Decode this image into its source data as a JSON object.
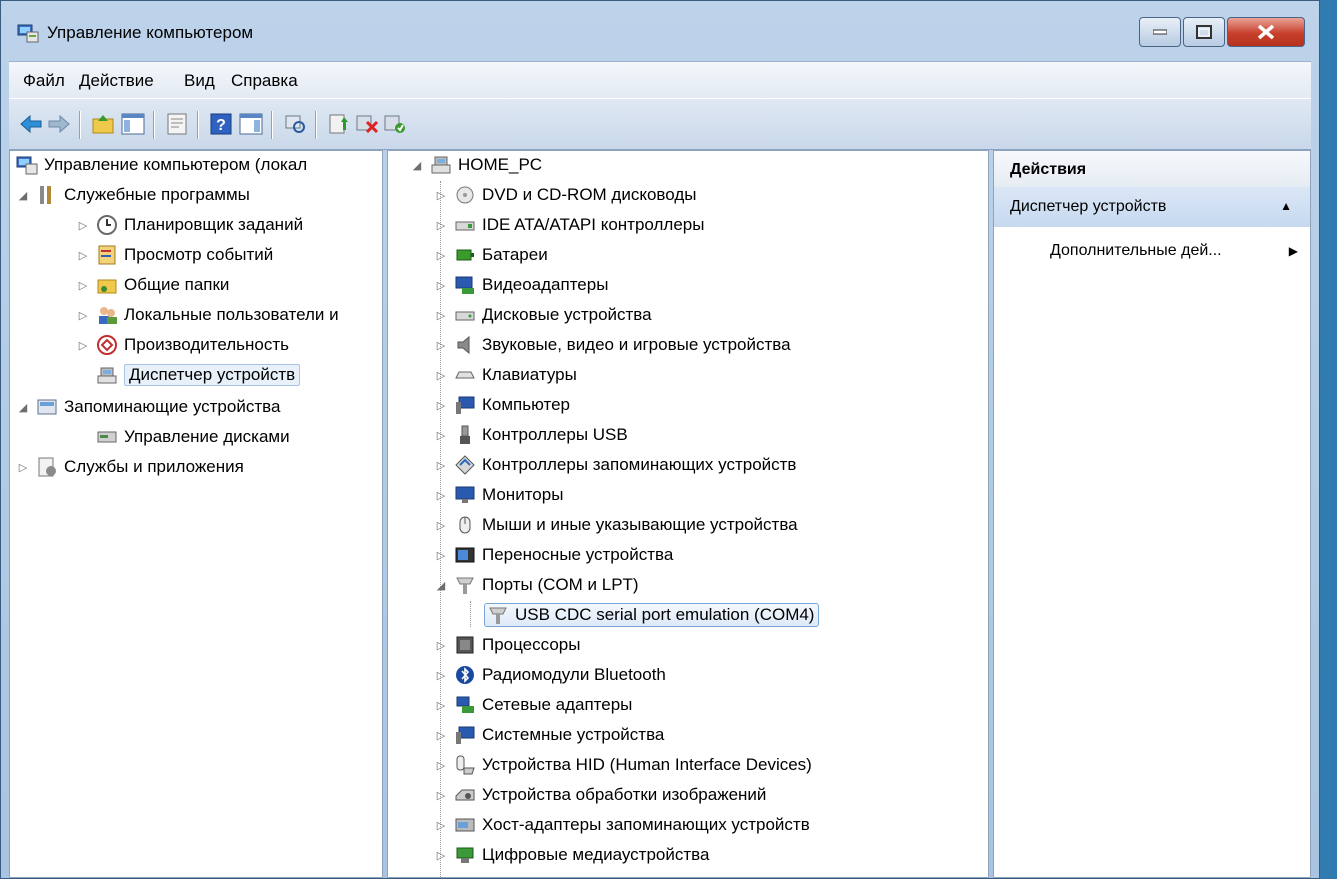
{
  "window": {
    "title": "Управление компьютером",
    "controls": {
      "minimize": "—",
      "maximize": "□",
      "close": "X"
    }
  },
  "menu": [
    "Файл",
    "Действие",
    "Вид",
    "Справка"
  ],
  "toolbar": {
    "icons": [
      "back-arrow-icon",
      "forward-arrow-icon",
      "up-folder-icon",
      "show-hide-tree-icon",
      "properties-icon",
      "help-icon",
      "action-pane-icon",
      "scan-hardware-icon",
      "update-driver-icon",
      "uninstall-icon",
      "enable-icon"
    ]
  },
  "left_tree": {
    "root": "Управление компьютером (локал",
    "items": [
      {
        "label": "Служебные программы",
        "expanded": true
      },
      {
        "label": "Планировщик заданий"
      },
      {
        "label": "Просмотр событий"
      },
      {
        "label": "Общие папки"
      },
      {
        "label": "Локальные пользователи и"
      },
      {
        "label": "Производительность"
      },
      {
        "label": "Диспетчер устройств",
        "selected": true
      },
      {
        "label": "Запоминающие устройства",
        "expanded": true
      },
      {
        "label": "Управление дисками"
      },
      {
        "label": "Службы и приложения"
      }
    ]
  },
  "device_tree": {
    "root": "HOME_PC",
    "categories": [
      "DVD и CD-ROM дисководы",
      "IDE ATA/ATAPI контроллеры",
      "Батареи",
      "Видеоадаптеры",
      "Дисковые устройства",
      "Звуковые, видео и игровые устройства",
      "Клавиатуры",
      "Компьютер",
      "Контроллеры USB",
      "Контроллеры запоминающих устройств",
      "Мониторы",
      "Мыши и иные указывающие устройства",
      "Переносные устройства",
      "Порты (COM и LPT)",
      "USB CDC serial port emulation (COM4)",
      "Процессоры",
      "Радиомодули Bluetooth",
      "Сетевые адаптеры",
      "Системные устройства",
      "Устройства HID (Human Interface Devices)",
      "Устройства обработки изображений",
      "Хост-адаптеры запоминающих устройств",
      "Цифровые медиаустройства"
    ]
  },
  "actions": {
    "header": "Действия",
    "section": "Диспетчер устройств",
    "more": "Дополнительные дей..."
  }
}
